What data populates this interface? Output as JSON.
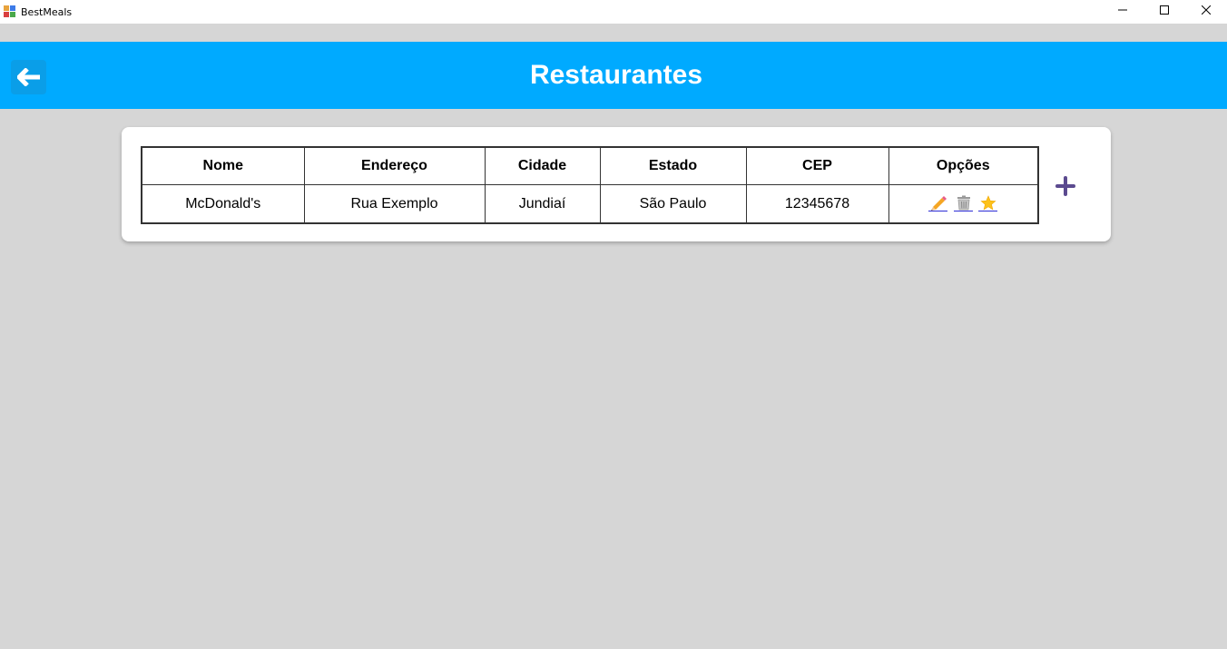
{
  "window": {
    "title": "BestMeals"
  },
  "header": {
    "title": "Restaurantes"
  },
  "table": {
    "columns": [
      "Nome",
      "Endereço",
      "Cidade",
      "Estado",
      "CEP",
      "Opções"
    ],
    "rows": [
      {
        "nome": "McDonald's",
        "endereco": "Rua Exemplo",
        "cidade": "Jundiaí",
        "estado": "São Paulo",
        "cep": "12345678",
        "options": [
          "pencil-icon",
          "trash-icon",
          "star-icon"
        ]
      }
    ]
  },
  "colors": {
    "header": "#00aaff",
    "back_button": "#0a9ee8",
    "add_icon": "#5b4a8f",
    "background": "#d6d6d6"
  }
}
